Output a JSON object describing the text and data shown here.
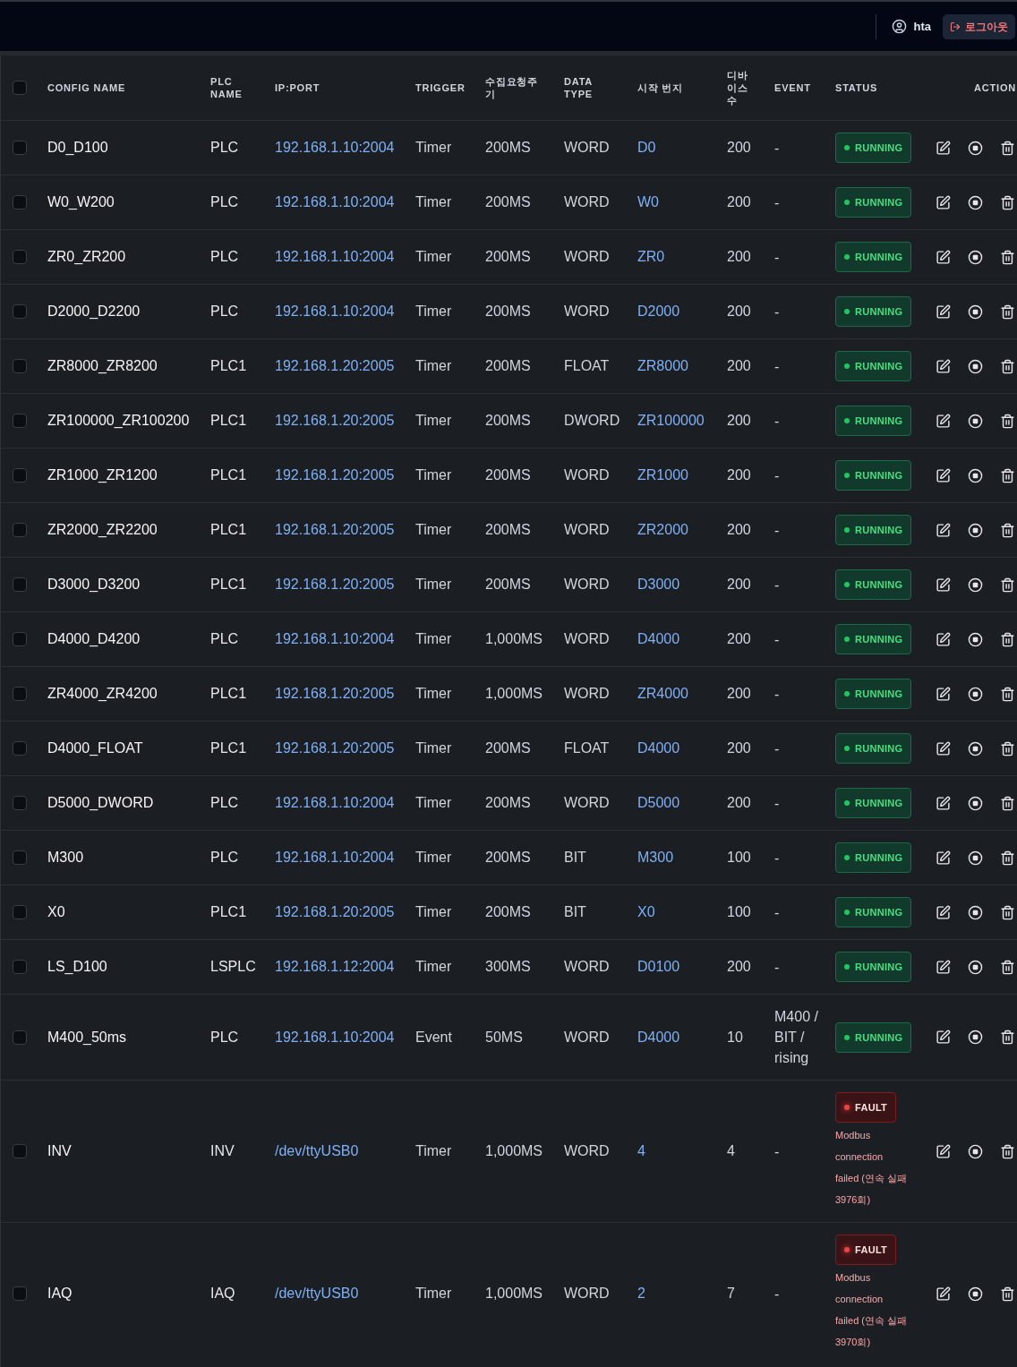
{
  "top_bar": {
    "user": "hta",
    "logout_button": "로그아웃"
  },
  "table": {
    "select_all": {
      "checked": false
    },
    "columns": [
      "CONFIG NAME",
      "PLC NAME",
      "IP:PORT",
      "TRIGGER",
      "수집요청주기",
      "DATA TYPE",
      "시작 번지",
      "디바이스 수",
      "EVENT",
      "STATUS",
      "ACTION"
    ],
    "rows": [
      {
        "checked": false,
        "config_name": "D0_D100",
        "plc_name": "PLC",
        "ip_port": "192.168.1.10:2004",
        "trigger": "Timer",
        "interval": "200MS",
        "data_type": "WORD",
        "start_address": "D0",
        "device_count": "200",
        "event": "-",
        "status": {
          "kind": "running",
          "label": "RUNNING"
        }
      },
      {
        "checked": false,
        "config_name": "W0_W200",
        "plc_name": "PLC",
        "ip_port": "192.168.1.10:2004",
        "trigger": "Timer",
        "interval": "200MS",
        "data_type": "WORD",
        "start_address": "W0",
        "device_count": "200",
        "event": "-",
        "status": {
          "kind": "running",
          "label": "RUNNING"
        }
      },
      {
        "checked": false,
        "config_name": "ZR0_ZR200",
        "plc_name": "PLC",
        "ip_port": "192.168.1.10:2004",
        "trigger": "Timer",
        "interval": "200MS",
        "data_type": "WORD",
        "start_address": "ZR0",
        "device_count": "200",
        "event": "-",
        "status": {
          "kind": "running",
          "label": "RUNNING"
        }
      },
      {
        "checked": false,
        "config_name": "D2000_D2200",
        "plc_name": "PLC",
        "ip_port": "192.168.1.10:2004",
        "trigger": "Timer",
        "interval": "200MS",
        "data_type": "WORD",
        "start_address": "D2000",
        "device_count": "200",
        "event": "-",
        "status": {
          "kind": "running",
          "label": "RUNNING"
        }
      },
      {
        "checked": false,
        "config_name": "ZR8000_ZR8200",
        "plc_name": "PLC1",
        "ip_port": "192.168.1.20:2005",
        "trigger": "Timer",
        "interval": "200MS",
        "data_type": "FLOAT",
        "start_address": "ZR8000",
        "device_count": "200",
        "event": "-",
        "status": {
          "kind": "running",
          "label": "RUNNING"
        }
      },
      {
        "checked": false,
        "config_name": "ZR100000_ZR100200",
        "plc_name": "PLC1",
        "ip_port": "192.168.1.20:2005",
        "trigger": "Timer",
        "interval": "200MS",
        "data_type": "DWORD",
        "start_address": "ZR100000",
        "device_count": "200",
        "event": "-",
        "status": {
          "kind": "running",
          "label": "RUNNING"
        }
      },
      {
        "checked": false,
        "config_name": "ZR1000_ZR1200",
        "plc_name": "PLC1",
        "ip_port": "192.168.1.20:2005",
        "trigger": "Timer",
        "interval": "200MS",
        "data_type": "WORD",
        "start_address": "ZR1000",
        "device_count": "200",
        "event": "-",
        "status": {
          "kind": "running",
          "label": "RUNNING"
        }
      },
      {
        "checked": false,
        "config_name": "ZR2000_ZR2200",
        "plc_name": "PLC1",
        "ip_port": "192.168.1.20:2005",
        "trigger": "Timer",
        "interval": "200MS",
        "data_type": "WORD",
        "start_address": "ZR2000",
        "device_count": "200",
        "event": "-",
        "status": {
          "kind": "running",
          "label": "RUNNING"
        }
      },
      {
        "checked": false,
        "config_name": "D3000_D3200",
        "plc_name": "PLC1",
        "ip_port": "192.168.1.20:2005",
        "trigger": "Timer",
        "interval": "200MS",
        "data_type": "WORD",
        "start_address": "D3000",
        "device_count": "200",
        "event": "-",
        "status": {
          "kind": "running",
          "label": "RUNNING"
        }
      },
      {
        "checked": false,
        "config_name": "D4000_D4200",
        "plc_name": "PLC",
        "ip_port": "192.168.1.10:2004",
        "trigger": "Timer",
        "interval": "1,000MS",
        "data_type": "WORD",
        "start_address": "D4000",
        "device_count": "200",
        "event": "-",
        "status": {
          "kind": "running",
          "label": "RUNNING"
        }
      },
      {
        "checked": false,
        "config_name": "ZR4000_ZR4200",
        "plc_name": "PLC1",
        "ip_port": "192.168.1.20:2005",
        "trigger": "Timer",
        "interval": "1,000MS",
        "data_type": "WORD",
        "start_address": "ZR4000",
        "device_count": "200",
        "event": "-",
        "status": {
          "kind": "running",
          "label": "RUNNING"
        }
      },
      {
        "checked": false,
        "config_name": "D4000_FLOAT",
        "plc_name": "PLC1",
        "ip_port": "192.168.1.20:2005",
        "trigger": "Timer",
        "interval": "200MS",
        "data_type": "FLOAT",
        "start_address": "D4000",
        "device_count": "200",
        "event": "-",
        "status": {
          "kind": "running",
          "label": "RUNNING"
        }
      },
      {
        "checked": false,
        "config_name": "D5000_DWORD",
        "plc_name": "PLC",
        "ip_port": "192.168.1.10:2004",
        "trigger": "Timer",
        "interval": "200MS",
        "data_type": "WORD",
        "start_address": "D5000",
        "device_count": "200",
        "event": "-",
        "status": {
          "kind": "running",
          "label": "RUNNING"
        }
      },
      {
        "checked": false,
        "config_name": "M300",
        "plc_name": "PLC",
        "ip_port": "192.168.1.10:2004",
        "trigger": "Timer",
        "interval": "200MS",
        "data_type": "BIT",
        "start_address": "M300",
        "device_count": "100",
        "event": "-",
        "status": {
          "kind": "running",
          "label": "RUNNING"
        }
      },
      {
        "checked": false,
        "config_name": "X0",
        "plc_name": "PLC1",
        "ip_port": "192.168.1.20:2005",
        "trigger": "Timer",
        "interval": "200MS",
        "data_type": "BIT",
        "start_address": "X0",
        "device_count": "100",
        "event": "-",
        "status": {
          "kind": "running",
          "label": "RUNNING"
        }
      },
      {
        "checked": false,
        "config_name": "LS_D100",
        "plc_name": "LSPLC",
        "ip_port": "192.168.1.12:2004",
        "trigger": "Timer",
        "interval": "300MS",
        "data_type": "WORD",
        "start_address": "D0100",
        "device_count": "200",
        "event": "-",
        "status": {
          "kind": "running",
          "label": "RUNNING"
        }
      },
      {
        "checked": false,
        "config_name": "M400_50ms",
        "plc_name": "PLC",
        "ip_port": "192.168.1.10:2004",
        "trigger": "Event",
        "interval": "50MS",
        "data_type": "WORD",
        "start_address": "D4000",
        "device_count": "10",
        "event": "M400 / BIT / rising",
        "status": {
          "kind": "running",
          "label": "RUNNING"
        }
      },
      {
        "checked": false,
        "config_name": "INV",
        "plc_name": "INV",
        "ip_port": "/dev/ttyUSB0",
        "trigger": "Timer",
        "interval": "1,000MS",
        "data_type": "WORD",
        "start_address": "4",
        "device_count": "4",
        "event": "-",
        "status": {
          "kind": "fault",
          "label": "FAULT",
          "message": "Modbus connection failed (연속 실패 3976회)"
        }
      },
      {
        "checked": false,
        "config_name": "IAQ",
        "plc_name": "IAQ",
        "ip_port": "/dev/ttyUSB0",
        "trigger": "Timer",
        "interval": "1,000MS",
        "data_type": "WORD",
        "start_address": "2",
        "device_count": "7",
        "event": "-",
        "status": {
          "kind": "fault",
          "label": "FAULT",
          "message": "Modbus connection failed (연속 실패 3970회)"
        }
      }
    ]
  }
}
